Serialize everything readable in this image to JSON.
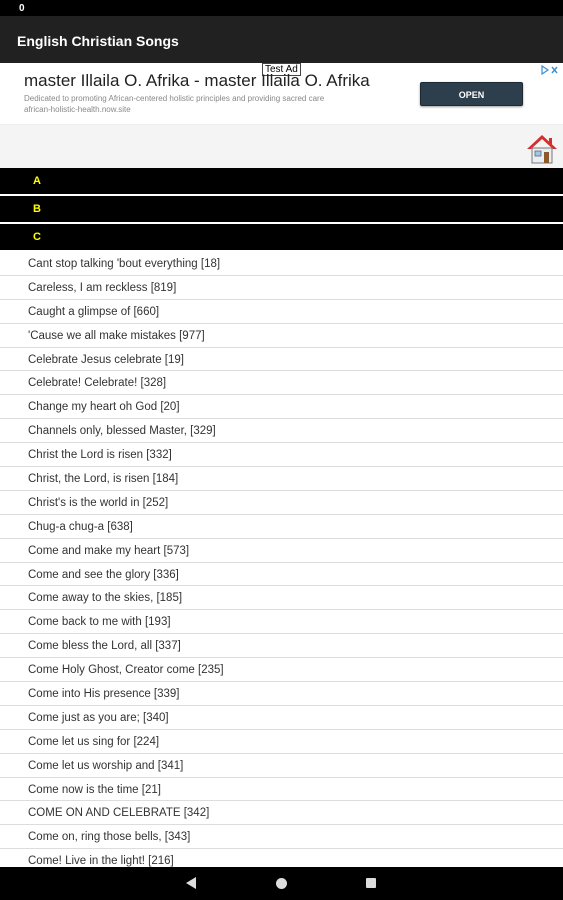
{
  "status_bar": {
    "indicator": "0"
  },
  "app_bar": {
    "title": "English Christian Songs"
  },
  "ad": {
    "label": "Test Ad",
    "title": "master Illaila O. Afrika - master Illaila O. Afrika",
    "description": "Dedicated to promoting African-centered holistic principles and providing sacred care",
    "url": "african-holistic-health.now.site",
    "button_label": "OPEN",
    "choices_icon": "adchoices-icon"
  },
  "home": {
    "icon": "home-icon"
  },
  "sections": [
    {
      "label": "A"
    },
    {
      "label": "B"
    },
    {
      "label": "C"
    }
  ],
  "songs": [
    "Cant stop talking 'bout everything [18]",
    "Careless, I am reckless [819]",
    "Caught a glimpse of [660]",
    "'Cause we all make mistakes [977]",
    "Celebrate Jesus celebrate [19]",
    "Celebrate! Celebrate! [328]",
    "Change my heart oh God [20]",
    "Channels only, blessed Master, [329]",
    "Christ the Lord is risen [332]",
    "Christ, the Lord, is risen [184]",
    "Christ's is the world in [252]",
    "Chug-a chug-a [638]",
    "Come and make my heart [573]",
    "Come and see the glory [336]",
    "Come away to the skies, [185]",
    "Come back to me with [193]",
    "Come bless the Lord, all [337]",
    "Come Holy Ghost, Creator come [235]",
    "Come into His presence [339]",
    "Come just as you are; [340]",
    "Come let us sing for [224]",
    "Come let us worship and [341]",
    "Come now is the time [21]",
    "COME ON AND CELEBRATE [342]",
    "Come on, ring those bells, [343]",
    "Come! Live in the light! [216]"
  ],
  "nav": {
    "back_icon": "back-icon",
    "home_icon": "home-circle-icon",
    "recents_icon": "recents-icon"
  },
  "colors": {
    "section_bg": "#000000",
    "section_text": "#ffff00",
    "app_bar": "#212121",
    "ad_button": "#2d3e4c"
  }
}
